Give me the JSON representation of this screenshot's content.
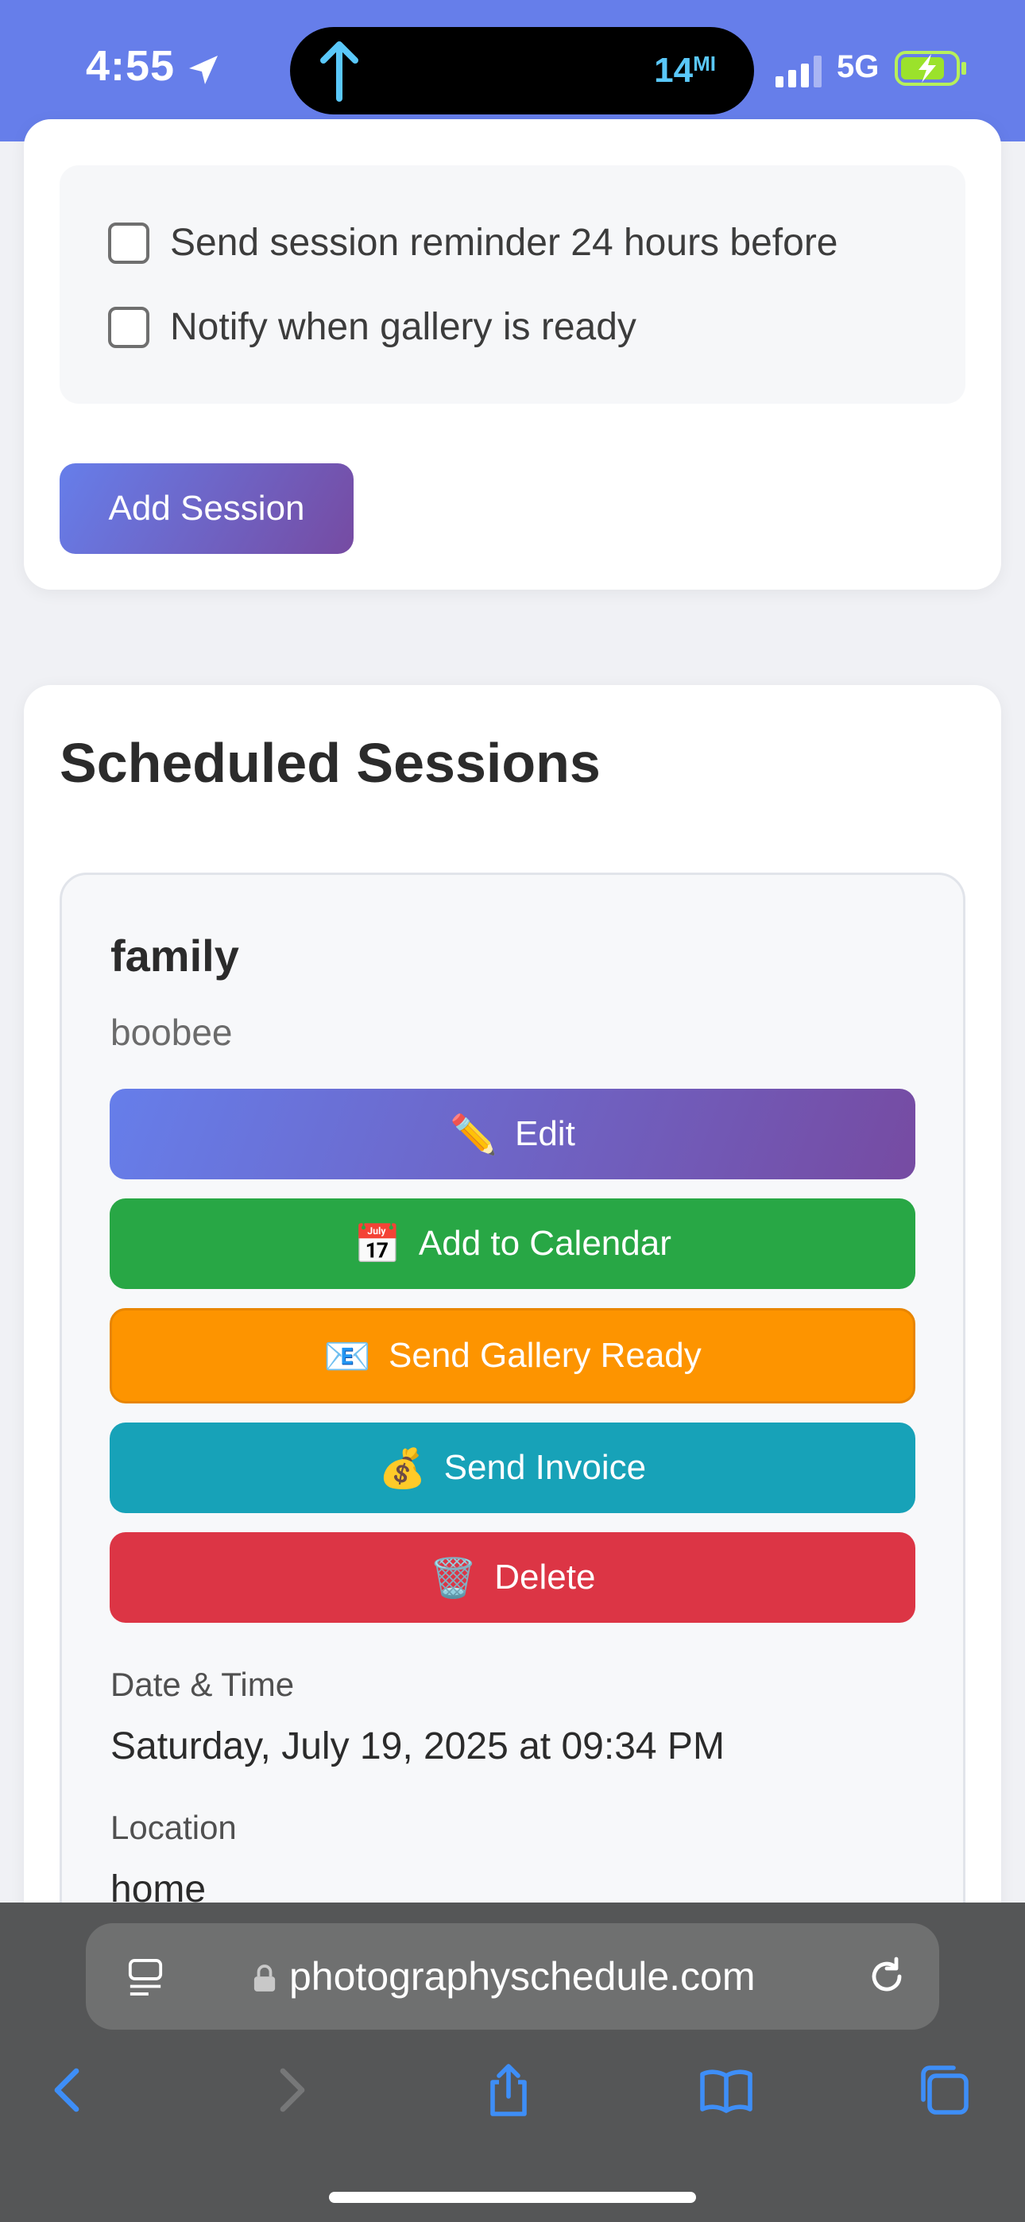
{
  "status_bar": {
    "time": "4:55",
    "navigation_distance": "14",
    "navigation_unit": "MI",
    "network": "5G"
  },
  "session_form": {
    "checkbox_reminder_label": "Send session reminder 24 hours before",
    "checkbox_gallery_label": "Notify when gallery is ready",
    "reminder_checked": false,
    "gallery_checked": false,
    "add_session_label": "Add Session"
  },
  "scheduled": {
    "title": "Scheduled Sessions",
    "session": {
      "type": "family",
      "client": "boobee",
      "buttons": {
        "edit": {
          "emoji": "✏️",
          "label": "Edit"
        },
        "calendar": {
          "emoji": "📅",
          "label": "Add to Calendar"
        },
        "gallery": {
          "emoji": "📧",
          "label": "Send Gallery Ready"
        },
        "invoice": {
          "emoji": "💰",
          "label": "Send Invoice"
        },
        "delete": {
          "emoji": "🗑️",
          "label": "Delete"
        }
      },
      "datetime_label": "Date & Time",
      "datetime_value": "Saturday, July 19, 2025 at 09:34 PM",
      "location_label": "Location",
      "location_value": "home"
    }
  },
  "browser": {
    "url": "photographyschedule.com"
  },
  "colors": {
    "accent": "#667eea",
    "accent_end": "#764ba2",
    "calendar": "#28a745",
    "gallery": "#fd9400",
    "invoice": "#17a2b8",
    "delete": "#dc3545",
    "toolbar_icon": "#3e8ef7"
  },
  "icons": [
    "location-arrow-icon",
    "navigation-arrow-icon",
    "signal-icon",
    "battery-charging-icon",
    "reader-icon",
    "lock-icon",
    "reload-icon",
    "back-icon",
    "forward-icon",
    "share-icon",
    "bookmarks-icon",
    "tabs-icon"
  ]
}
